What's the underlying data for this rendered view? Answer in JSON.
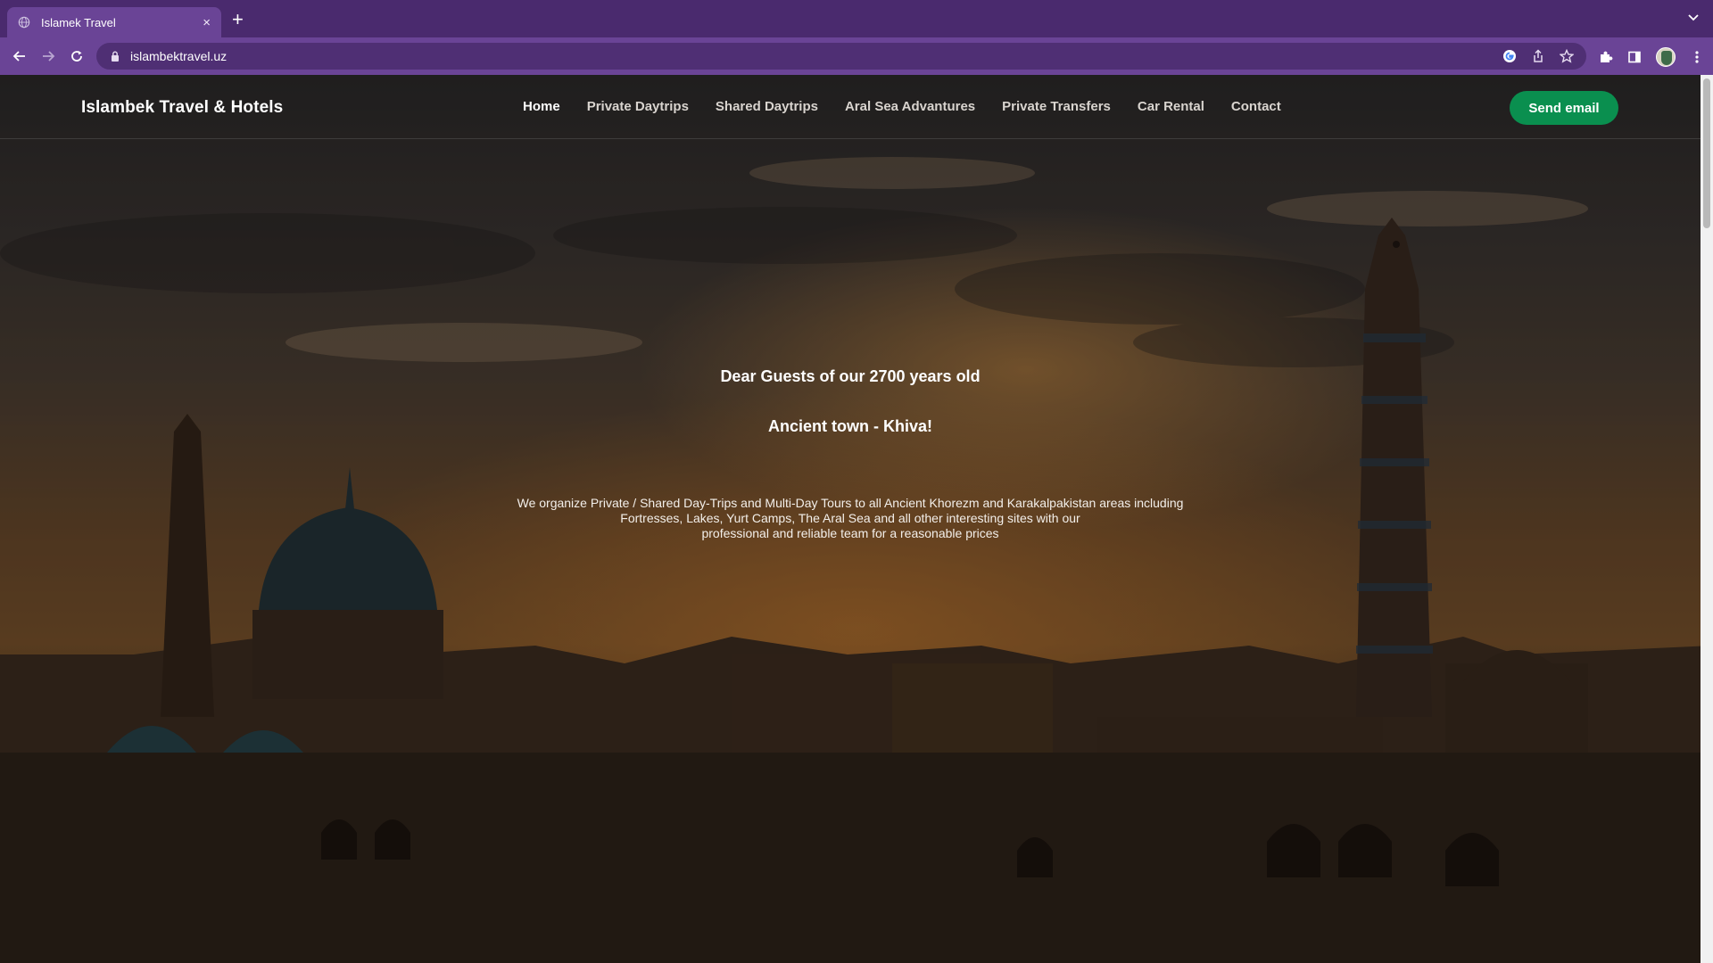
{
  "browser": {
    "tab_title": "Islamek Travel",
    "url": "islambektravel.uz",
    "new_tab_label": "+",
    "close_label": "×"
  },
  "site": {
    "brand": "Islambek Travel & Hotels",
    "nav": [
      "Home",
      "Private Daytrips",
      "Shared Daytrips",
      "Aral Sea Advantures",
      "Private Transfers",
      "Car Rental",
      "Contact"
    ],
    "active_nav": "Home",
    "cta_label": "Send email"
  },
  "hero": {
    "line1": "Dear Guests of our 2700 years old",
    "line2": "Ancient town - Khiva!",
    "paragraph_lines": [
      "We organize Private / Shared Day-Trips and Multi-Day Tours to all Ancient Khorezm and Karakalpakistan areas including",
      "Fortresses, Lakes, Yurt Camps, The Aral Sea and all other interesting sites with our",
      "professional and reliable team for a reasonable prices"
    ]
  },
  "colors": {
    "browser_frame": "#4a2a6e",
    "toolbar": "#6a4496",
    "cta": "#0a8f4f"
  },
  "icons": [
    "globe-icon",
    "close-icon",
    "plus-icon",
    "chevron-down-icon",
    "back-icon",
    "forward-icon",
    "reload-icon",
    "lock-icon",
    "google-icon",
    "share-icon",
    "star-icon",
    "puzzle-icon",
    "sidepanel-icon",
    "avatar",
    "menu-dots-icon"
  ]
}
